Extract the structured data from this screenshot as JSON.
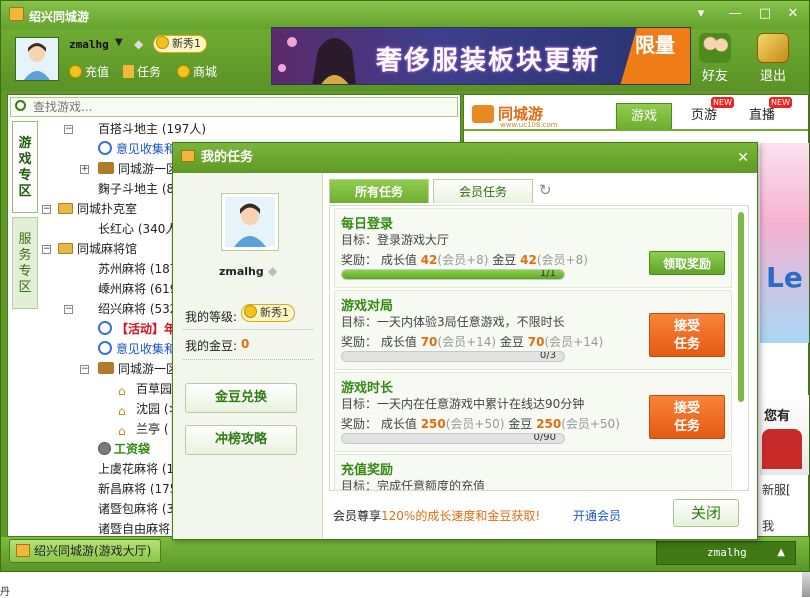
{
  "window": {
    "title": "绍兴同城游"
  },
  "header": {
    "username": "zmalhg",
    "level": "新秀1",
    "links": [
      "充值",
      "任务",
      "商城"
    ],
    "banner_text": "奢侈服装板块更新",
    "banner_tag": "限量",
    "friends_label": "好友",
    "exit_label": "退出"
  },
  "sidebar": {
    "search_placeholder": "查找游戏...",
    "vtab_games": "游戏专区",
    "vtab_service": "服务专区",
    "tree": [
      {
        "label": "百搭斗地主",
        "count": "(197人)"
      },
      {
        "label": "意见收集和",
        "count": ""
      },
      {
        "label": "同城游一区",
        "count": ""
      },
      {
        "label": "麴子斗地主",
        "count": "(83"
      },
      {
        "label": "同城扑克室",
        "count": ""
      },
      {
        "label": "长红心",
        "count": "(340人)"
      },
      {
        "label": "同城麻将馆",
        "count": ""
      },
      {
        "label": "苏州麻将",
        "count": "(187"
      },
      {
        "label": "嵊州麻将",
        "count": "(619"
      },
      {
        "label": "绍兴麻将",
        "count": "(532"
      },
      {
        "label": "【活动】年",
        "count": ""
      },
      {
        "label": "意见收集和",
        "count": ""
      },
      {
        "label": "同城游一区",
        "count": ""
      },
      {
        "label": "百草园",
        "count": ""
      },
      {
        "label": "沈园",
        "count": "(>"
      },
      {
        "label": "兰亭",
        "count": "("
      },
      {
        "label": "工资袋",
        "count": ""
      },
      {
        "label": "上虞花麻将",
        "count": "(1"
      },
      {
        "label": "新昌麻将",
        "count": "(175"
      },
      {
        "label": "诸暨包麻将",
        "count": "(3"
      },
      {
        "label": "诸暨自由麻将",
        "count": ""
      }
    ]
  },
  "right_panel": {
    "logo": "同城游",
    "logo_url": "www.uc108.com",
    "tabs": [
      {
        "label": "游戏",
        "badge": ""
      },
      {
        "label": "页游",
        "badge": "NEW"
      },
      {
        "label": "直播",
        "badge": "NEW"
      }
    ],
    "promo_text": "Le",
    "promo_caption": "您有",
    "news_label": "新服[",
    "misc_char": "我"
  },
  "statusbar": {
    "tab_label": "绍兴同城游(游戏大厅)",
    "user": "zmalhg"
  },
  "dialog": {
    "title": "我的任务",
    "username": "zmalhg",
    "level_label": "我的等级:",
    "level_value": "新秀1",
    "beans_label": "我的金豆:",
    "beans_value": "0",
    "exchange_btn": "金豆兑换",
    "strategy_btn": "冲榜攻略",
    "tabs": [
      "所有任务",
      "会员任务"
    ],
    "tasks": [
      {
        "name": "每日登录",
        "target": "目标：登录游戏大厅",
        "reward_prefix": "奖励：",
        "growth_label": "成长值",
        "growth": "42",
        "growth_vip": "(会员+8)",
        "bean_label": "金豆",
        "bean": "42",
        "bean_vip": "(会员+8)",
        "progress_text": "1/1",
        "progress": 1.0,
        "button": "领取奖励"
      },
      {
        "name": "游戏对局",
        "target": "目标：一天内体验3局任意游戏，不限时长",
        "reward_prefix": "奖励：",
        "growth_label": "成长值",
        "growth": "70",
        "growth_vip": "(会员+14)",
        "bean_label": "金豆",
        "bean": "70",
        "bean_vip": "(会员+14)",
        "progress_text": "0/3",
        "progress": 0,
        "button": "接受任务"
      },
      {
        "name": "游戏时长",
        "target": "目标：一天内在任意游戏中累计在线达90分钟",
        "reward_prefix": "奖励：",
        "growth_label": "成长值",
        "growth": "250",
        "growth_vip": "(会员+50)",
        "bean_label": "金豆",
        "bean": "250",
        "bean_vip": "(会员+50)",
        "progress_text": "0/90",
        "progress": 0,
        "button": "接受任务"
      },
      {
        "name": "充值奖励",
        "target": "目标：完成任意额度的充值"
      }
    ],
    "footer_prefix": "会员尊享",
    "footer_highlight": "120%的成长速度和金豆获取!",
    "footer_link": "开通会员",
    "close_btn": "关闭"
  },
  "bottom_char": "丹",
  "colors": {
    "theme_green": "#5f9a28",
    "accent_orange": "#f06a1c",
    "reward_orange": "#e36d10",
    "link_blue": "#1a56c8"
  }
}
